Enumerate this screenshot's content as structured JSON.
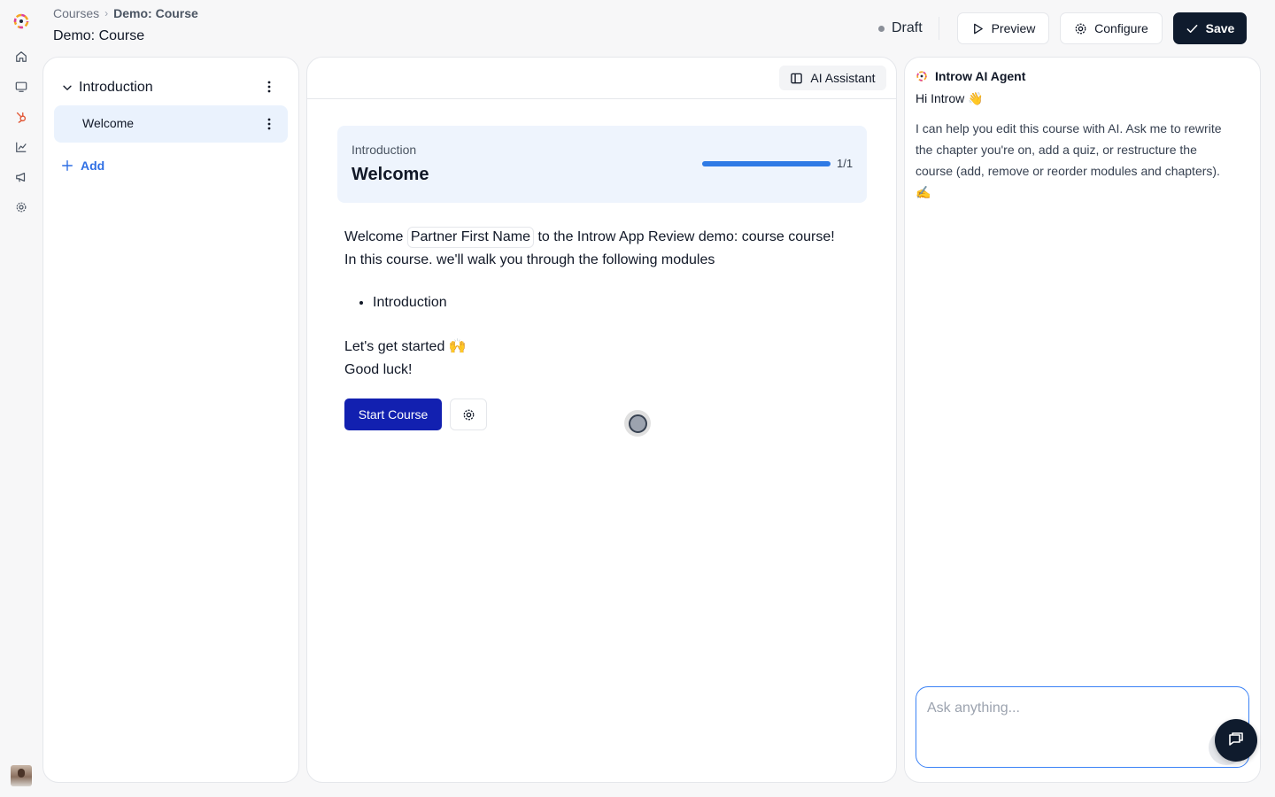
{
  "breadcrumb": {
    "root": "Courses",
    "separator": "›",
    "current": "Demo: Course"
  },
  "page_title": "Demo: Course",
  "status": {
    "label": "Draft"
  },
  "toolbar": {
    "preview_label": "Preview",
    "configure_label": "Configure",
    "save_label": "Save"
  },
  "outline": {
    "module": {
      "label": "Introduction"
    },
    "chapters": [
      {
        "label": "Welcome",
        "selected": true
      }
    ],
    "add_label": "Add"
  },
  "editor": {
    "ai_assistant_label": "AI Assistant",
    "card": {
      "module": "Introduction",
      "chapter": "Welcome",
      "progress": 1.0,
      "progress_text": "1/1"
    },
    "content": {
      "p1_before": "Welcome",
      "chip": "Partner First Name",
      "p1_after": "to the Introw App Review demo: course course!",
      "p1_line2": "In this course. we'll walk you through the following modules",
      "bullets": [
        "Introduction"
      ],
      "p2_line1": "Let's get started 🙌",
      "p2_line2": "Good luck!"
    },
    "start_label": "Start Course"
  },
  "agent": {
    "title": "Introw AI Agent",
    "greeting": "Hi Introw 👋",
    "message": "I can help you edit this course with AI. Ask me to rewrite the chapter you're on, add a quiz, or restructure the course (add, remove or reorder modules and chapters). ✍️",
    "input_placeholder": "Ask anything..."
  },
  "colors": {
    "accent": "#2f7ae5",
    "primary_dark": "#0f1b2d",
    "start_button": "#1220b0",
    "brand": "#e25a3a"
  }
}
